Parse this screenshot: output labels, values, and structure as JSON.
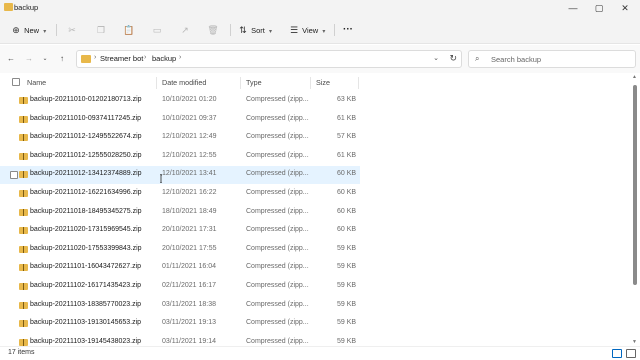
{
  "window": {
    "title": "backup",
    "minimize_glyph": "—",
    "maximize_glyph": "▢",
    "close_glyph": "✕"
  },
  "toolbar": {
    "new_label": "New",
    "sort_label": "Sort",
    "view_label": "View",
    "more_glyph": "···"
  },
  "address": {
    "crumbs": [
      "Streamer bot",
      "backup"
    ]
  },
  "search": {
    "placeholder": "Search backup"
  },
  "columns": {
    "name": "Name",
    "date_modified": "Date modified",
    "type": "Type",
    "size": "Size"
  },
  "files": [
    {
      "name": "backup-20211010-01202180713.zip",
      "date": "10/10/2021 01:20",
      "type": "Compressed (zipp...",
      "size": "63 KB"
    },
    {
      "name": "backup-20211010-09374117245.zip",
      "date": "10/10/2021 09:37",
      "type": "Compressed (zipp...",
      "size": "61 KB"
    },
    {
      "name": "backup-20211012-12495522674.zip",
      "date": "12/10/2021 12:49",
      "type": "Compressed (zipp...",
      "size": "57 KB"
    },
    {
      "name": "backup-20211012-12555028250.zip",
      "date": "12/10/2021 12:55",
      "type": "Compressed (zipp...",
      "size": "61 KB"
    },
    {
      "name": "backup-20211012-13412374889.zip",
      "date": "12/10/2021 13:41",
      "type": "Compressed (zipp...",
      "size": "60 KB"
    },
    {
      "name": "backup-20211012-16221634996.zip",
      "date": "12/10/2021 16:22",
      "type": "Compressed (zipp...",
      "size": "60 KB"
    },
    {
      "name": "backup-20211018-18495345275.zip",
      "date": "18/10/2021 18:49",
      "type": "Compressed (zipp...",
      "size": "60 KB"
    },
    {
      "name": "backup-20211020-17315969545.zip",
      "date": "20/10/2021 17:31",
      "type": "Compressed (zipp...",
      "size": "60 KB"
    },
    {
      "name": "backup-20211020-17553399843.zip",
      "date": "20/10/2021 17:55",
      "type": "Compressed (zipp...",
      "size": "59 KB"
    },
    {
      "name": "backup-20211101-16043472627.zip",
      "date": "01/11/2021 16:04",
      "type": "Compressed (zipp...",
      "size": "59 KB"
    },
    {
      "name": "backup-20211102-16171435423.zip",
      "date": "02/11/2021 16:17",
      "type": "Compressed (zipp...",
      "size": "59 KB"
    },
    {
      "name": "backup-20211103-18385770023.zip",
      "date": "03/11/2021 18:38",
      "type": "Compressed (zipp...",
      "size": "59 KB"
    },
    {
      "name": "backup-20211103-19130145653.zip",
      "date": "03/11/2021 19:13",
      "type": "Compressed (zipp...",
      "size": "59 KB"
    },
    {
      "name": "backup-20211103-19145438023.zip",
      "date": "03/11/2021 19:14",
      "type": "Compressed (zipp...",
      "size": "59 KB"
    }
  ],
  "hovered_row": 4,
  "status": {
    "item_count": "17 items"
  },
  "colors": {
    "accent": "#0067c0",
    "hover": "#e5f3ff",
    "folder": "#e8b84a"
  }
}
